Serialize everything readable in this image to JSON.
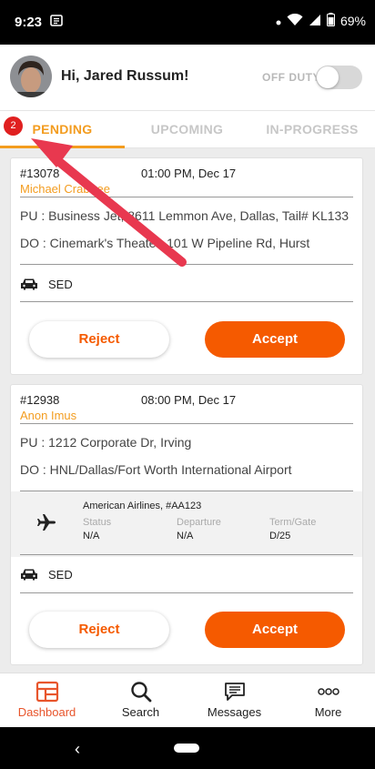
{
  "status_bar": {
    "time": "9:23",
    "battery": "69%"
  },
  "header": {
    "greeting": "Hi, Jared Russum!",
    "duty_label": "OFF DUTY",
    "duty_on": false
  },
  "tabs": [
    {
      "label": "PENDING",
      "active": true,
      "badge": "2"
    },
    {
      "label": "UPCOMING",
      "active": false
    },
    {
      "label": "IN-PROGRESS",
      "active": false
    }
  ],
  "trips": [
    {
      "id": "#13078",
      "time": "01:00 PM, Dec 17",
      "passenger": "Michael Crabtree",
      "pickup": "PU : Business Jet, 8611 Lemmon Ave, Dallas, Tail# KL133",
      "dropoff": "DO : Cinemark's Theater, 101 W Pipeline Rd, Hurst",
      "vehicle": "SED",
      "reject_label": "Reject",
      "accept_label": "Accept"
    },
    {
      "id": "#12938",
      "time": "08:00 PM, Dec 17",
      "passenger": "Anon Imus",
      "pickup": "PU : 1212 Corporate Dr, Irving",
      "dropoff": "DO : HNL/Dallas/Fort Worth International Airport",
      "flight": {
        "name": "American Airlines, #AA123",
        "status_label": "Status",
        "status_value": "N/A",
        "departure_label": "Departure",
        "departure_value": "N/A",
        "gate_label": "Term/Gate",
        "gate_value": "D/25"
      },
      "vehicle": "SED",
      "reject_label": "Reject",
      "accept_label": "Accept"
    }
  ],
  "bottom_nav": [
    {
      "label": "Dashboard",
      "icon": "dashboard-icon",
      "active": true
    },
    {
      "label": "Search",
      "icon": "search-icon",
      "active": false
    },
    {
      "label": "Messages",
      "icon": "messages-icon",
      "active": false
    },
    {
      "label": "More",
      "icon": "more-icon",
      "active": false
    }
  ],
  "colors": {
    "accent": "#f39c1f",
    "accept": "#f55a00",
    "badge": "#e02020",
    "arrow": "#e8384f"
  }
}
